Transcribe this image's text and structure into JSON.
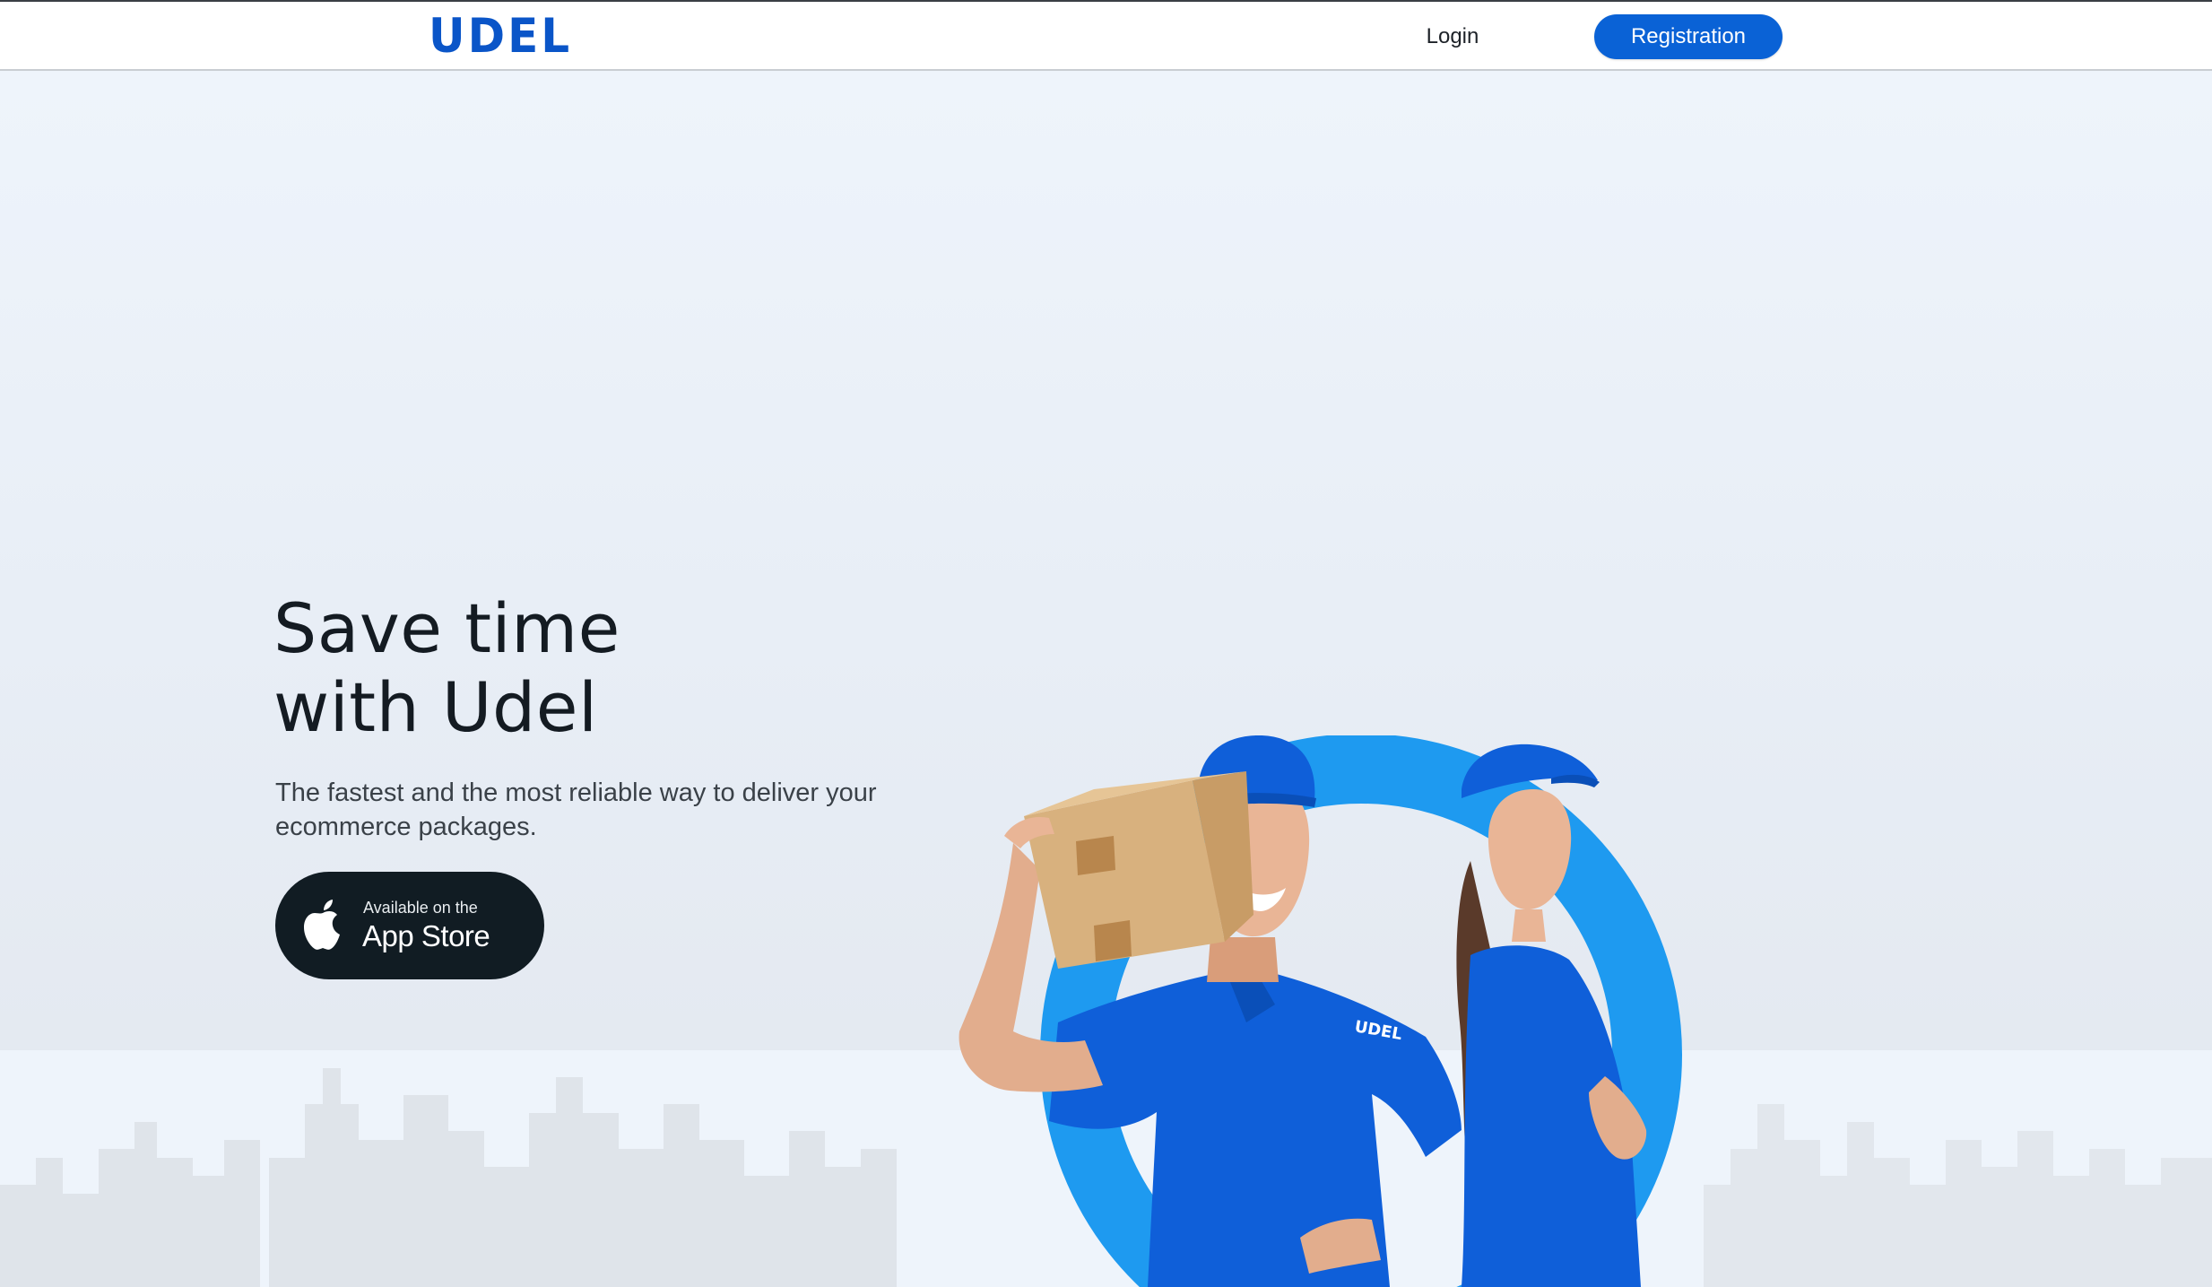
{
  "header": {
    "logo": "UDEL",
    "login_label": "Login",
    "registration_label": "Registration"
  },
  "hero": {
    "headline_line1": "Save time",
    "headline_line2": "with Udel",
    "subtext": "The fastest and the most reliable way to deliver your ecommerce packages.",
    "app_store": {
      "small_label": "Available on the",
      "big_label": "App Store",
      "icon": "apple-icon"
    },
    "shirt_logo": "UDEL"
  },
  "colors": {
    "brand_blue": "#0a55c8",
    "button_blue": "#0a62d6",
    "ring_blue": "#1e9af0",
    "uniform_blue": "#0f5fd9",
    "app_store_bg": "#111c23"
  }
}
